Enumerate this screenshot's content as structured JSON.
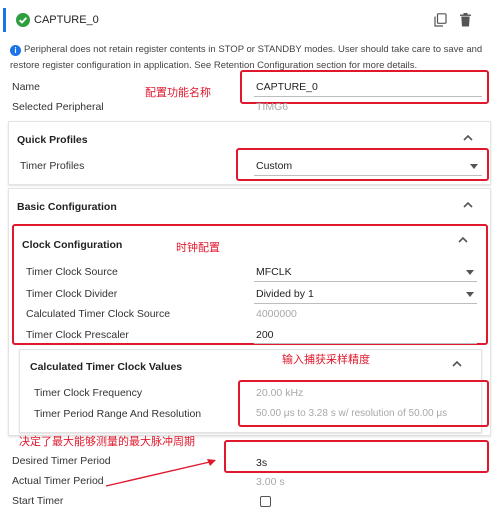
{
  "header": {
    "title": "CAPTURE_0"
  },
  "info": {
    "text": "Peripheral does not retain register contents in STOP or STANDBY modes. User should take care to save and restore register configuration in application. See Retention Configuration section for more details."
  },
  "fields": {
    "name": {
      "label": "Name",
      "value": "CAPTURE_0"
    },
    "selected_peripheral": {
      "label": "Selected Peripheral",
      "value": "TIMG6"
    }
  },
  "quick_profiles": {
    "title": "Quick Profiles",
    "timer_profiles": {
      "label": "Timer Profiles",
      "value": "Custom"
    }
  },
  "basic_configuration": {
    "title": "Basic Configuration"
  },
  "clock_configuration": {
    "title": "Clock Configuration",
    "timer_clock_source": {
      "label": "Timer Clock Source",
      "value": "MFCLK"
    },
    "timer_clock_divider": {
      "label": "Timer Clock Divider",
      "value": "Divided by 1"
    },
    "calculated_timer_clock_source": {
      "label": "Calculated Timer Clock Source",
      "value": "4000000"
    },
    "timer_clock_prescaler": {
      "label": "Timer Clock Prescaler",
      "value": "200"
    }
  },
  "calculated_values": {
    "title": "Calculated Timer Clock Values",
    "timer_clock_frequency": {
      "label": "Timer Clock Frequency",
      "value": "20.00 kHz"
    },
    "timer_period_range": {
      "label": "Timer Period Range And Resolution",
      "value": "50.00 μs to 3.28 s w/ resolution of 50.00 μs"
    }
  },
  "timer": {
    "desired_period": {
      "label": "Desired Timer Period",
      "value": "3s"
    },
    "actual_period": {
      "label": "Actual Timer Period",
      "value": "3.00 s"
    },
    "start_timer": {
      "label": "Start Timer"
    }
  },
  "annotations": {
    "name_note": "配置功能名称",
    "clock_note": "时钟配置",
    "prescaler_note": "输入捕获采样精度",
    "period_note": "决定了最大能够测量的最大脉冲周期"
  },
  "colors": {
    "accent": "#1a73e8",
    "success": "#2e9e3f",
    "annotation": "#e0182d"
  }
}
